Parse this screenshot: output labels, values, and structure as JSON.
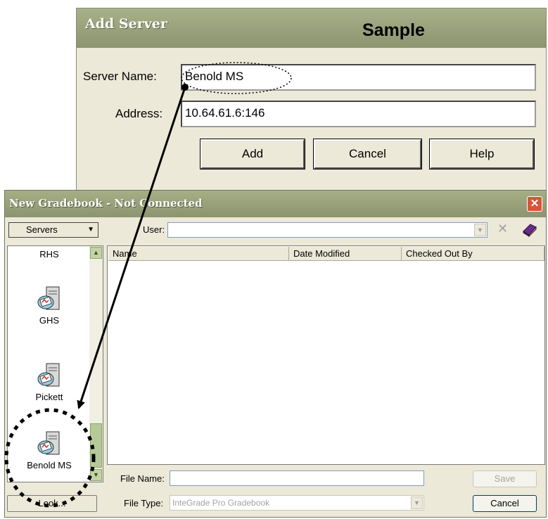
{
  "add_server": {
    "title": "Add Server",
    "sample_label": "Sample",
    "server_name_label": "Server Name:",
    "server_name_value": "Benold MS",
    "address_label": "Address:",
    "address_value": "10.64.61.6:146",
    "add_button": "Add",
    "cancel_button": "Cancel",
    "help_button": "Help"
  },
  "gradebook": {
    "title": "New Gradebook - Not Connected",
    "servers_dropdown": "Servers",
    "user_label": "User:",
    "user_value": "",
    "servers": [
      {
        "name": "RHS"
      },
      {
        "name": "GHS"
      },
      {
        "name": "Pickett"
      },
      {
        "name": "Benold MS"
      }
    ],
    "columns": [
      "Name",
      "Date Modified",
      "Checked Out By"
    ],
    "file_name_label": "File Name:",
    "file_name_value": "",
    "file_type_label": "File Type:",
    "file_type_value": "InteGrade Pro Gradebook",
    "save_button": "Save",
    "cancel_button": "Cancel",
    "look_button": "Look..."
  },
  "colors": {
    "title_bar": "#8c9470",
    "close_button": "#d8553a",
    "annotation": "#000000"
  }
}
